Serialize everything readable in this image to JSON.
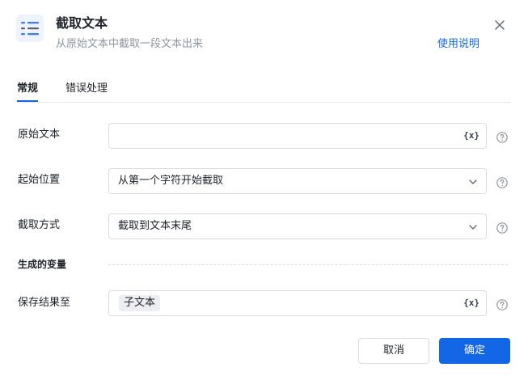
{
  "header": {
    "title": "截取文本",
    "subtitle": "从原始文本中截取一段文本出来",
    "help_link": "使用说明",
    "icon": "text-list-icon",
    "close_icon": "close-icon"
  },
  "tabs": [
    {
      "label": "常规",
      "active": true
    },
    {
      "label": "错误处理",
      "active": false
    }
  ],
  "form": {
    "source_text": {
      "label": "原始文本",
      "value": "",
      "var_icon": "{x}"
    },
    "start_position": {
      "label": "起始位置",
      "value": "从第一个字符开始截取"
    },
    "cut_mode": {
      "label": "截取方式",
      "value": "截取到文本末尾"
    }
  },
  "output": {
    "section_title": "生成的变量",
    "save_to": {
      "label": "保存结果至",
      "chip": "子文本",
      "var_icon": "{x}"
    }
  },
  "footer": {
    "cancel": "取消",
    "confirm": "确定"
  },
  "colors": {
    "accent": "#1366e6",
    "border": "#d9dce1",
    "muted_text": "#8f959e"
  }
}
